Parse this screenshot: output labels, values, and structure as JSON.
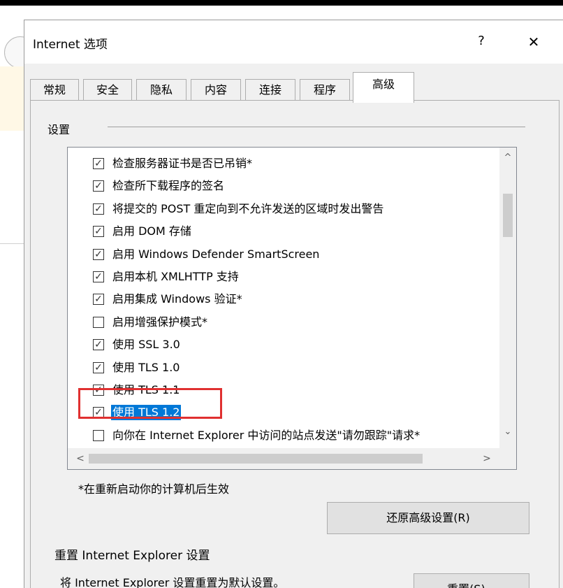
{
  "window": {
    "title": "Internet 选项",
    "help_label": "?",
    "close_label": "✕"
  },
  "background": {
    "back_icon": "back-arrow-icon",
    "favicon": "favicon-icon"
  },
  "tabs": [
    {
      "label": "常规",
      "active": false
    },
    {
      "label": "安全",
      "active": false
    },
    {
      "label": "隐私",
      "active": false
    },
    {
      "label": "内容",
      "active": false
    },
    {
      "label": "连接",
      "active": false
    },
    {
      "label": "程序",
      "active": false
    },
    {
      "label": "高级",
      "active": true
    }
  ],
  "settings": {
    "group_label": "设置",
    "items": [
      {
        "label": "检查服务器证书是否已吊销*",
        "checked": true,
        "selected": false
      },
      {
        "label": "检查所下载程序的签名",
        "checked": true,
        "selected": false
      },
      {
        "label": "将提交的 POST 重定向到不允许发送的区域时发出警告",
        "checked": true,
        "selected": false
      },
      {
        "label": "启用 DOM 存储",
        "checked": true,
        "selected": false
      },
      {
        "label": "启用 Windows Defender SmartScreen",
        "checked": true,
        "selected": false
      },
      {
        "label": "启用本机 XMLHTTP 支持",
        "checked": true,
        "selected": false
      },
      {
        "label": "启用集成 Windows 验证*",
        "checked": true,
        "selected": false
      },
      {
        "label": "启用增强保护模式*",
        "checked": false,
        "selected": false
      },
      {
        "label": "使用 SSL 3.0",
        "checked": true,
        "selected": false
      },
      {
        "label": "使用 TLS 1.0",
        "checked": true,
        "selected": false
      },
      {
        "label": "使用 TLS 1.1",
        "checked": true,
        "selected": false
      },
      {
        "label": "使用 TLS 1.2",
        "checked": true,
        "selected": true
      },
      {
        "label": "向你在 Internet Explorer 中访问的站点发送\"请勿跟踪\"请求*",
        "checked": false,
        "selected": false
      }
    ],
    "checkmark": "✓",
    "scroll_up": "^",
    "scroll_down": "⌄",
    "scroll_left": "<",
    "scroll_right": ">",
    "restart_note": "*在重新启动你的计算机后生效",
    "restore_button": "还原高级设置(R)"
  },
  "reset": {
    "group_label": "重置 Internet Explorer 设置",
    "description": "将 Internet Explorer 设置重置为默认设置。",
    "button": "重置(S)..."
  },
  "colors": {
    "selection": "#0078d7",
    "highlight_box": "#e03030"
  }
}
